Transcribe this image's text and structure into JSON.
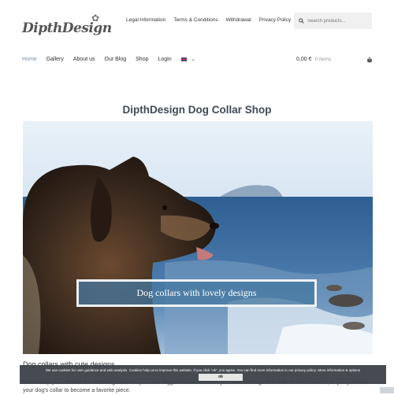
{
  "header": {
    "logo_text": "DipthDesign",
    "top_links": [
      "Legal Information",
      "Terms & Conditions",
      "Withdrawal",
      "Privacy Policy"
    ],
    "search": {
      "placeholder": "Search products..."
    }
  },
  "nav": {
    "items": [
      "Home",
      "Gallery",
      "About us",
      "Our Blog",
      "Shop",
      "Login"
    ],
    "active_index": 0
  },
  "cart": {
    "amount": "0,00 €",
    "items": "0 items"
  },
  "main": {
    "title": "DipthDesign Dog Collar Shop",
    "banner_text": "Dog collars with lovely designs",
    "subheading": "Dog collars with cute designs",
    "body_text": "In our shop you can find the matching collar for your four-legged friend. Whether you want a design that reflects his character, or you just wish your dog's collar to become a favorite piece."
  },
  "cookie": {
    "text": "We use cookies for user guidance and web analysis. Cookies help us to improve this website. If you click \"ok\", you agree. You can find more information in our privacy policy: More information & options",
    "button": "ok"
  },
  "colors": {
    "accent": "#7a8fa8",
    "title": "#3e4a56",
    "cookie_bg": "#3c4048"
  }
}
